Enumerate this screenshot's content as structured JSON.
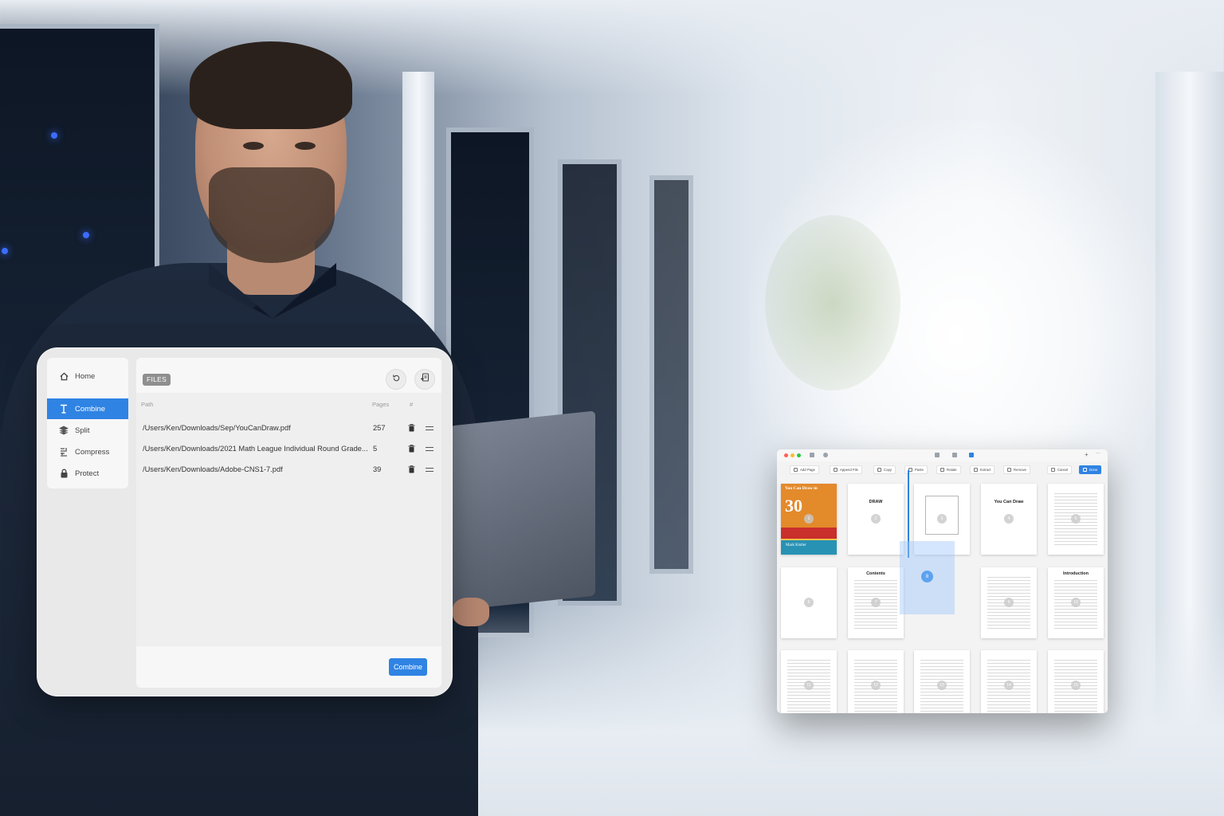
{
  "sidebar": {
    "items": [
      {
        "label": "Home",
        "icon": "home-icon"
      },
      {
        "label": "Combine",
        "icon": "combine-icon",
        "active": true
      },
      {
        "label": "Split",
        "icon": "layers-icon"
      },
      {
        "label": "Compress",
        "icon": "compress-icon"
      },
      {
        "label": "Protect",
        "icon": "lock-icon"
      }
    ]
  },
  "files_panel": {
    "badge": "FILES",
    "columns": {
      "path": "Path",
      "pages": "Pages",
      "extra": "#"
    },
    "rows": [
      {
        "path": "/Users/Ken/Downloads/Sep/YouCanDraw.pdf",
        "pages": "257"
      },
      {
        "path": "/Users/Ken/Downloads/2021 Math League Individual Round Grade...",
        "pages": "5"
      },
      {
        "path": "/Users/Ken/Downloads/Adobe-CNS1-7.pdf",
        "pages": "39"
      }
    ],
    "combine_label": "Combine",
    "accent": "#2f83e3"
  },
  "organizer": {
    "toolbar": [
      "Add Page",
      "Append File",
      "Copy",
      "Paste",
      "Rotate",
      "Extract",
      "Remove",
      "Cancel",
      "Done"
    ],
    "cover": {
      "title_top": "You Can Draw in",
      "big": "30",
      "word": "Days",
      "author": "Mark Kistler"
    },
    "page_titles": {
      "p2": "DRAW",
      "p4": "You Can Draw",
      "p7": "Contents",
      "p10": "Introduction"
    },
    "page_numbers": [
      "1",
      "2",
      "3",
      "4",
      "5",
      "6",
      "7",
      "8",
      "9",
      "10",
      "11",
      "12",
      "13",
      "14",
      "15"
    ],
    "dragging_page": "8"
  }
}
